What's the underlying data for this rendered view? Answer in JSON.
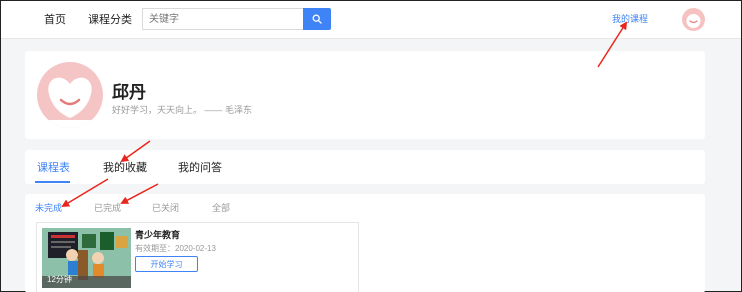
{
  "header": {
    "nav_home": "首页",
    "nav_courses": "课程分类",
    "search_placeholder": "关键字",
    "my_courses": "我的课程"
  },
  "profile": {
    "name": "邱丹",
    "motto": "好好学习，天天向上。 —— 毛泽东"
  },
  "tabs": [
    {
      "label": "课程表",
      "active": true
    },
    {
      "label": "我的收藏",
      "active": false
    },
    {
      "label": "我的问答",
      "active": false
    }
  ],
  "filters": [
    {
      "label": "未完成",
      "active": true
    },
    {
      "label": "已完成",
      "active": false
    },
    {
      "label": "已关闭",
      "active": false
    },
    {
      "label": "全部",
      "active": false
    }
  ],
  "course": {
    "title": "青少年教育",
    "expiry": "有效期至：2020-02-13",
    "action": "开始学习",
    "duration": "12分钟"
  },
  "colors": {
    "accent": "#3f84f7",
    "annotation": "#e8261c",
    "avatar": "#f5c5c5"
  },
  "icons": [
    "search-icon",
    "avatar-icon"
  ]
}
